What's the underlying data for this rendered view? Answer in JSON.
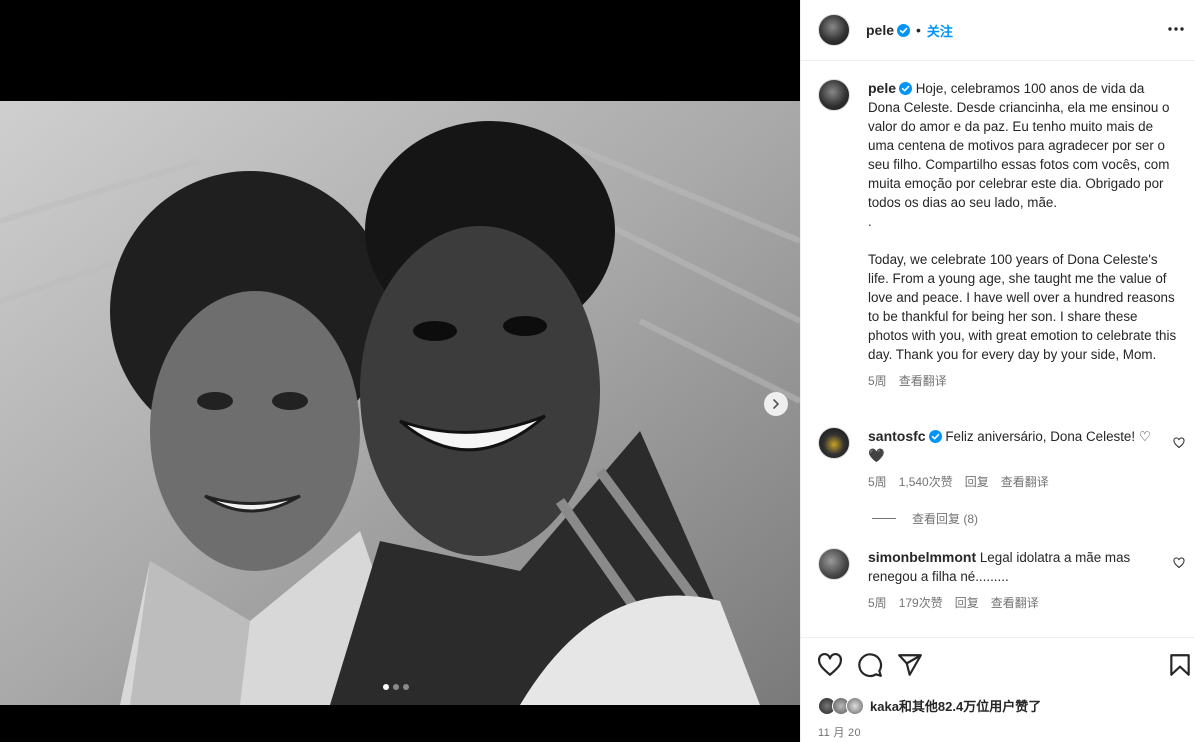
{
  "post": {
    "username": "pele",
    "follow_label": "关注",
    "separator": "•"
  },
  "caption": {
    "username": "pele",
    "text": "Hoje, celebramos 100 anos de vida da Dona Celeste. Desde criancinha, ela me ensinou o valor do amor e da paz. Eu tenho muito mais de uma centena de motivos para agradecer por ser o seu filho. Compartilho essas fotos com vocês, com muita emoção por celebrar este dia. Obrigado por todos os dias ao seu lado, mãe.\n.\n\nToday, we celebrate 100 years of Dona Celeste's life. From a young age, she taught me the value of love and peace. I have well over a hundred reasons to be thankful for being her son. I share these photos with you, with great emotion to celebrate this day. Thank you for every day by your side, Mom.",
    "time": "5周",
    "translate": "查看翻译"
  },
  "comments": [
    {
      "username": "santosfc",
      "text": "Feliz aniversário, Dona Celeste! ♡ 🖤",
      "time": "5周",
      "likes": "1,540次赞",
      "reply": "回复",
      "translate": "查看翻译",
      "view_replies": "查看回复 (8)"
    },
    {
      "username": "simonbelmmont",
      "text": "Legal idolatra a mãe mas renegou a filha né.........",
      "time": "5周",
      "likes": "179次赞",
      "reply": "回复",
      "translate": "查看翻译"
    }
  ],
  "likes_summary": "kaka和其他82.4万位用户赞了",
  "date": "11 月 20",
  "carousel": {
    "current": 1,
    "total": 3
  },
  "colors": {
    "accent": "#0095f6",
    "text": "#262626",
    "muted": "#737373",
    "border": "#efefef"
  },
  "icons": [
    "verified-badge-icon",
    "more-options-icon",
    "heart-icon",
    "comment-icon",
    "share-icon",
    "bookmark-icon",
    "chevron-right-icon"
  ]
}
